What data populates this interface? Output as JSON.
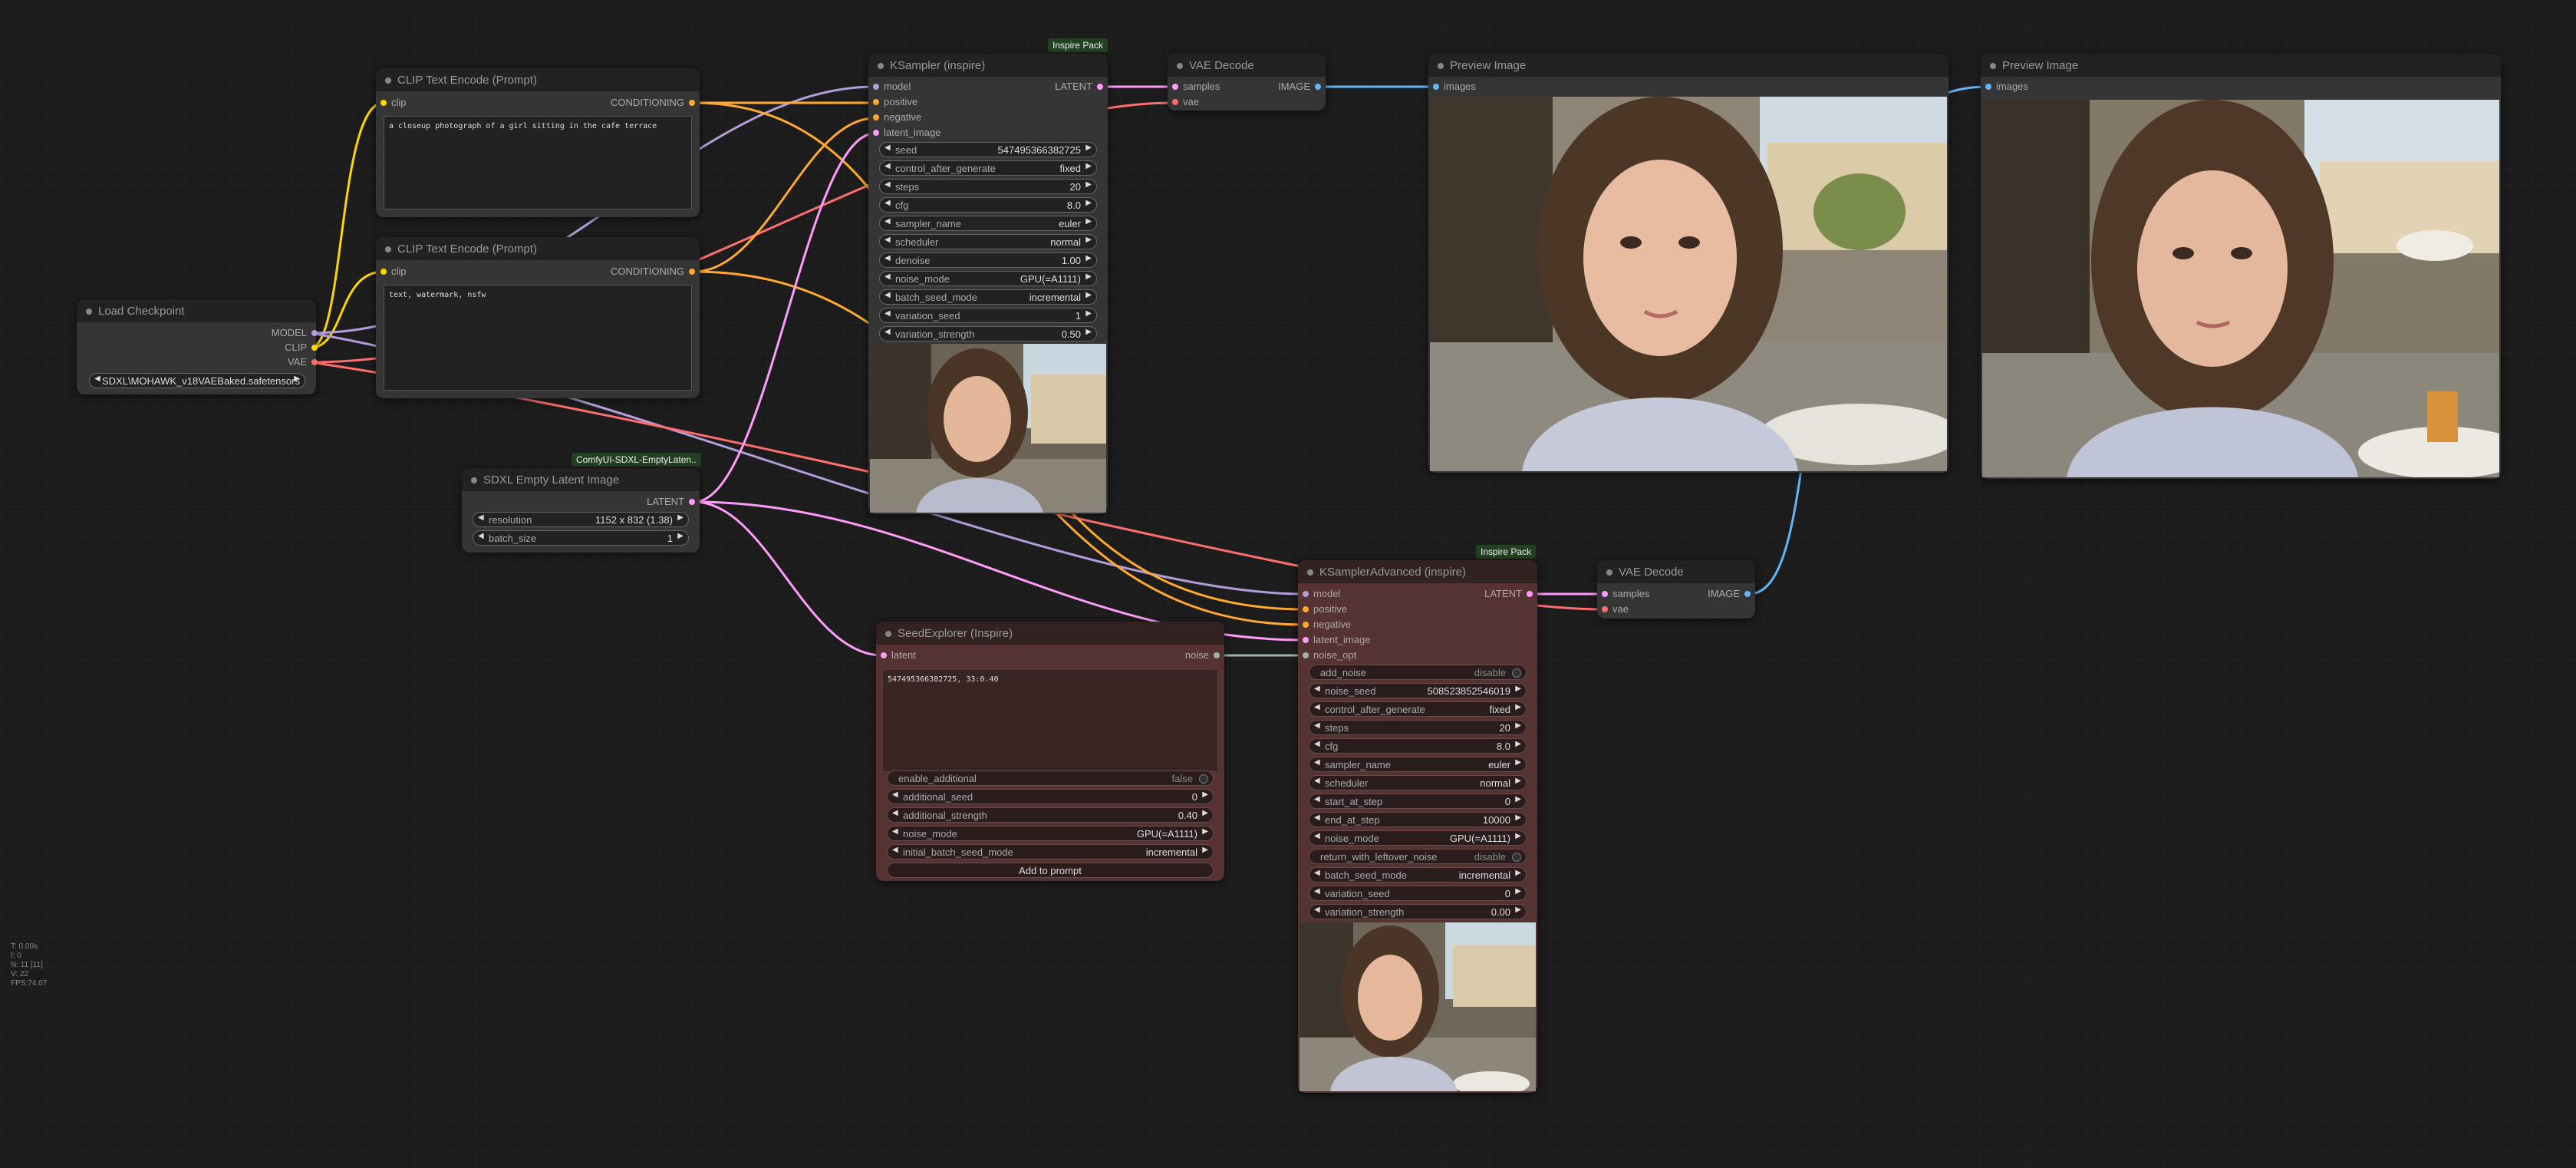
{
  "colors": {
    "model": "#b39ddb",
    "clip": "#ffd500",
    "vae": "#ff6e6e",
    "conditioning": "#ffa931",
    "latent": "#ff9cf9",
    "image": "#64b5f6",
    "noise": "#a1b3a7"
  },
  "nodes": {
    "load_checkpoint": {
      "title": "Load Checkpoint",
      "outputs": [
        "MODEL",
        "CLIP",
        "VAE"
      ],
      "ckpt_name": "SDXL\\MOHAWK_v18VAEBaked.safetensors"
    },
    "clip_pos": {
      "title": "CLIP Text Encode (Prompt)",
      "input": "clip",
      "output": "CONDITIONING",
      "text": "a closeup photograph of a girl sitting in the cafe terrace"
    },
    "clip_neg": {
      "title": "CLIP Text Encode (Prompt)",
      "input": "clip",
      "output": "CONDITIONING",
      "text": "text, watermark, nsfw"
    },
    "empty_latent": {
      "title": "SDXL Empty Latent Image",
      "badge": "ComfyUI-SDXL-EmptyLaten..",
      "output": "LATENT",
      "widgets": [
        {
          "label": "resolution",
          "value": "1152 x 832 (1.38)"
        },
        {
          "label": "batch_size",
          "value": "1"
        }
      ]
    },
    "ksampler": {
      "title": "KSampler (inspire)",
      "badge": "Inspire Pack",
      "inputs": [
        "model",
        "positive",
        "negative",
        "latent_image"
      ],
      "output": "LATENT",
      "widgets": [
        {
          "label": "seed",
          "value": "547495366382725"
        },
        {
          "label": "control_after_generate",
          "value": "fixed"
        },
        {
          "label": "steps",
          "value": "20"
        },
        {
          "label": "cfg",
          "value": "8.0"
        },
        {
          "label": "sampler_name",
          "value": "euler"
        },
        {
          "label": "scheduler",
          "value": "normal"
        },
        {
          "label": "denoise",
          "value": "1.00"
        },
        {
          "label": "noise_mode",
          "value": "GPU(=A1111)"
        },
        {
          "label": "batch_seed_mode",
          "value": "incremental"
        },
        {
          "label": "variation_seed",
          "value": "1"
        },
        {
          "label": "variation_strength",
          "value": "0.50"
        }
      ]
    },
    "vae_decode1": {
      "title": "VAE Decode",
      "inputs": [
        "samples",
        "vae"
      ],
      "output": "IMAGE"
    },
    "preview1": {
      "title": "Preview Image",
      "input": "images"
    },
    "preview2": {
      "title": "Preview Image",
      "input": "images"
    },
    "seed_explorer": {
      "title": "SeedExplorer (Inspire)",
      "input": "latent",
      "output": "noise",
      "text": "547495366382725, 33:0.40",
      "widgets": [
        {
          "label": "enable_additional",
          "value": "false",
          "toggle": true
        },
        {
          "label": "additional_seed",
          "value": "0"
        },
        {
          "label": "additional_strength",
          "value": "0.40"
        },
        {
          "label": "noise_mode",
          "value": "GPU(=A1111)"
        },
        {
          "label": "initial_batch_seed_mode",
          "value": "incremental"
        }
      ],
      "button": "Add to prompt"
    },
    "ksampler_adv": {
      "title": "KSamplerAdvanced (inspire)",
      "badge": "Inspire Pack",
      "inputs": [
        "model",
        "positive",
        "negative",
        "latent_image",
        "noise_opt"
      ],
      "output": "LATENT",
      "widgets": [
        {
          "label": "add_noise",
          "value": "disable",
          "toggle": true
        },
        {
          "label": "noise_seed",
          "value": "508523852546019"
        },
        {
          "label": "control_after_generate",
          "value": "fixed"
        },
        {
          "label": "steps",
          "value": "20"
        },
        {
          "label": "cfg",
          "value": "8.0"
        },
        {
          "label": "sampler_name",
          "value": "euler"
        },
        {
          "label": "scheduler",
          "value": "normal"
        },
        {
          "label": "start_at_step",
          "value": "0"
        },
        {
          "label": "end_at_step",
          "value": "10000"
        },
        {
          "label": "noise_mode",
          "value": "GPU(=A1111)"
        },
        {
          "label": "return_with_leftover_noise",
          "value": "disable",
          "toggle": true
        },
        {
          "label": "batch_seed_mode",
          "value": "incremental"
        },
        {
          "label": "variation_seed",
          "value": "0"
        },
        {
          "label": "variation_strength",
          "value": "0.00"
        }
      ]
    },
    "vae_decode2": {
      "title": "VAE Decode",
      "inputs": [
        "samples",
        "vae"
      ],
      "output": "IMAGE"
    }
  },
  "stats": [
    "T: 0.00s",
    "I: 0",
    "N: 11 [11]",
    "V: 22",
    "FPS:74.07"
  ]
}
